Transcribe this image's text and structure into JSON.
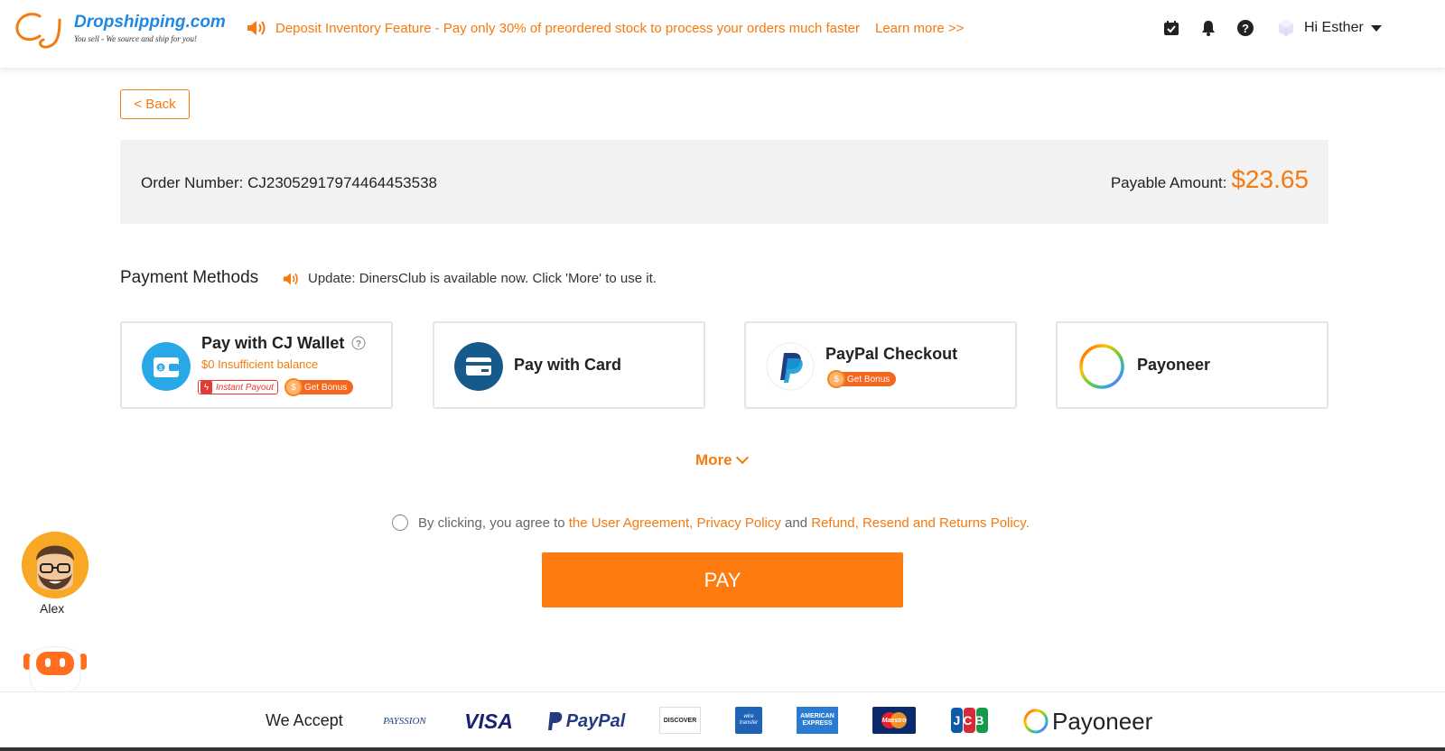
{
  "header": {
    "logo_text": "Dropshipping.com",
    "logo_tagline": "You sell - We source and ship for you!",
    "notice": "Deposit Inventory Feature - Pay only 30% of preordered stock to process your orders much faster",
    "learn_more": "Learn more >>",
    "greeting": "Hi Esther"
  },
  "back_label": "< Back",
  "order": {
    "number_label": "Order Number:",
    "number": "CJ23052917974464453538",
    "payable_label": "Payable Amount:",
    "payable_amount": "$23.65"
  },
  "payment": {
    "title": "Payment Methods",
    "update_text": "Update: DinersClub is available now. Click 'More' to use it.",
    "methods": [
      {
        "label": "Pay with CJ Wallet",
        "sub": "$0 Insufficient balance",
        "badges": [
          "Instant Payout",
          "Get Bonus"
        ]
      },
      {
        "label": "Pay with Card"
      },
      {
        "label": "PayPal Checkout",
        "badges": [
          "Get Bonus"
        ]
      },
      {
        "label": "Payoneer"
      }
    ],
    "more_label": "More"
  },
  "agreement": {
    "prefix": "By clicking, you agree to",
    "link1": "the User Agreement",
    "sep": ",",
    "link2": "Privacy Policy",
    "and": "and",
    "link3": "Refund, Resend and Returns Policy."
  },
  "pay_button": "PAY",
  "agent_name": "Alex",
  "footer": {
    "accept_label": "We Accept",
    "logos": [
      "PAYSSION",
      "VISA",
      "PayPal",
      "DISCOVER",
      "wire transfer",
      "AMERICAN EXPRESS",
      "Maestro",
      "JCB",
      "Payoneer"
    ]
  },
  "colors": {
    "accent": "#f57a0f",
    "pay_button": "#fd7b0f",
    "order_bar": "#f2f2f2"
  }
}
